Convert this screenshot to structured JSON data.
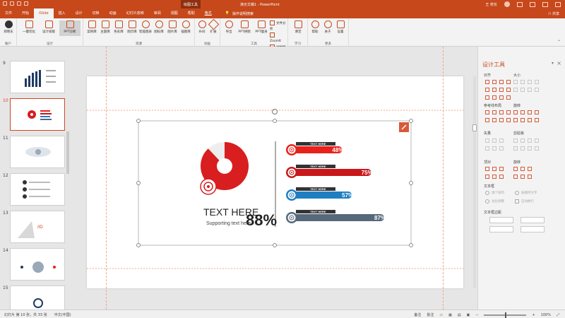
{
  "titlebar": {
    "tool_context": "绘图工具",
    "doc_title": "演示文稿1 - PowerPoint",
    "user": "王 校长",
    "share": "共享"
  },
  "tabs": [
    "文件",
    "开始",
    "iSlide",
    "插入",
    "设计",
    "切换",
    "动画",
    "幻灯片放映",
    "审阅",
    "视图",
    "帮助",
    "格式"
  ],
  "active_tab": "iSlide",
  "tell_me": "操作说明搜索",
  "ribbon": {
    "groups": [
      {
        "label": "账户",
        "buttons": [
          "郑晓东"
        ]
      },
      {
        "label": "设计",
        "buttons": [
          "一键优化",
          "设计排版",
          "PPT诊断"
        ]
      },
      {
        "label": "资源",
        "buttons": [
          "案例库",
          "主题库",
          "色彩库",
          "图示库",
          "智能图表",
          "图标库",
          "图片库",
          "插图库"
        ]
      },
      {
        "label": "动画",
        "buttons": [
          "补间",
          "扩展"
        ]
      },
      {
        "label": "工具",
        "buttons": [
          "导出",
          "PPT拼图",
          "PPT瘦身"
        ],
        "small": [
          "文件分析",
          "ZoomIt",
          "计时器"
        ]
      },
      {
        "label": "学习",
        "buttons": [
          "课堂"
        ]
      },
      {
        "label": "更多",
        "buttons": [
          "帮助",
          "关于",
          "设置"
        ]
      }
    ]
  },
  "thumbnails": [
    "9",
    "10",
    "11",
    "12",
    "13",
    "14",
    "15"
  ],
  "selected_slide": "10",
  "slide": {
    "main_text": "TEXT HERE",
    "main_pct": "88%",
    "main_value": 0.88,
    "supporting": "Supporting text here",
    "bars": [
      {
        "label": "TEXT HERE",
        "pct": "48%",
        "value": 0.48,
        "color": "#e8211b"
      },
      {
        "label": "TEXT HERE",
        "pct": "75%",
        "value": 0.75,
        "color": "#c9171a"
      },
      {
        "label": "TEXT HERE",
        "pct": "57%",
        "value": 0.57,
        "color": "#1f7ec2"
      },
      {
        "label": "TEXT HERE",
        "pct": "87%",
        "value": 0.87,
        "color": "#56687a"
      }
    ]
  },
  "pane": {
    "title": "设计工具",
    "sections": [
      "对齐",
      "大小",
      "参考线布局",
      "旋转",
      "矢量",
      "剪贴板",
      "顶对",
      "旋转",
      "文本框",
      "文本框边距"
    ],
    "text_options": [
      "逐个排列",
      "按顺序文字",
      "溢出调整",
      "自动换行"
    ]
  },
  "status": {
    "slide_info": "幻灯片 第 10 张，共 33 张",
    "lang": "中文(中国)",
    "notes": "备注",
    "comments": "批注",
    "zoom": "100%"
  },
  "colors": {
    "accent": "#c6481b",
    "red": "#e8211b",
    "blue": "#1f7ec2",
    "slate": "#56687a"
  }
}
